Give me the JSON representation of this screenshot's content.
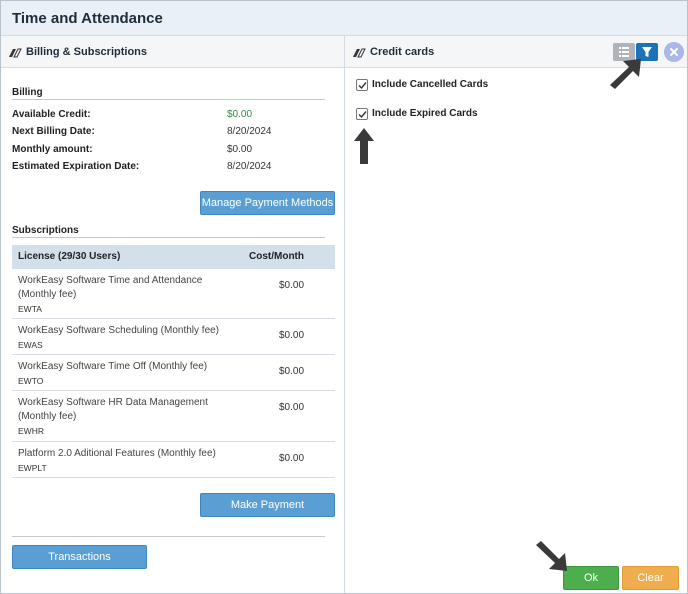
{
  "window": {
    "title": "Time and Attendance"
  },
  "left_panel": {
    "header": "Billing & Subscriptions",
    "billing": {
      "section_title": "Billing",
      "rows": [
        {
          "label": "Available Credit:",
          "value": "$0.00"
        },
        {
          "label": "Next Billing Date:",
          "value": "8/20/2024"
        },
        {
          "label": "Monthly amount:",
          "value": "$0.00"
        },
        {
          "label": "Estimated Expiration Date:",
          "value": "8/20/2024"
        }
      ],
      "manage_button": "Manage Payment Methods"
    },
    "subscriptions": {
      "section_title": "Subscriptions",
      "col_license": "License (29/30 Users)",
      "col_cost": "Cost/Month",
      "rows": [
        {
          "name": "WorkEasy Software Time and Attendance (Monthly fee)",
          "code": "EWTA",
          "cost": "$0.00"
        },
        {
          "name": "WorkEasy Software Scheduling (Monthly fee)",
          "code": "EWAS",
          "cost": "$0.00"
        },
        {
          "name": "WorkEasy Software Time Off (Monthly fee)",
          "code": "EWTO",
          "cost": "$0.00"
        },
        {
          "name": "WorkEasy Software HR Data Management (Monthly fee)",
          "code": "EWHR",
          "cost": "$0.00"
        },
        {
          "name": "Platform 2.0 Aditional Features (Monthly fee)",
          "code": "EWPLT",
          "cost": "$0.00"
        }
      ],
      "make_payment_button": "Make Payment"
    },
    "transactions_button": "Transactions"
  },
  "right_panel": {
    "header": "Credit cards",
    "icons": {
      "list": "list-view-icon",
      "filter": "filter-icon",
      "close": "close-icon"
    },
    "checkboxes": [
      {
        "label": "Include Cancelled Cards",
        "checked": true
      },
      {
        "label": "Include Expired Cards",
        "checked": true
      }
    ],
    "ok_button": "Ok",
    "clear_button": "Clear"
  },
  "colors": {
    "accent_blue": "#5a9fd4",
    "filter_blue": "#1a73b8",
    "ok_green": "#4cae4c",
    "clear_orange": "#f0ad4e",
    "credit_green": "#2e8b3a"
  }
}
